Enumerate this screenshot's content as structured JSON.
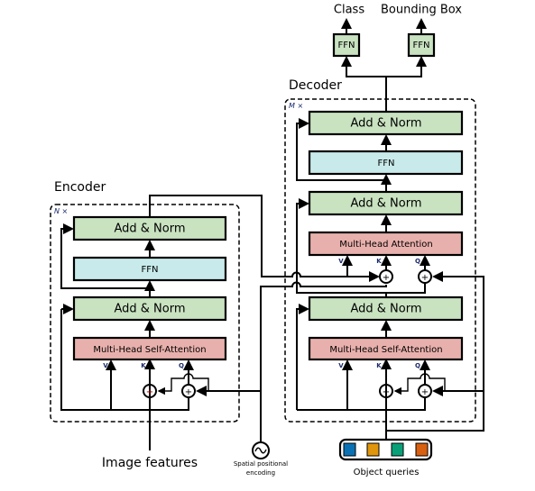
{
  "outputs": {
    "class": "Class",
    "bbox": "Bounding Box",
    "ffn": "FFN"
  },
  "encoder": {
    "title": "Encoder",
    "repeat": "N ×",
    "add_norm": "Add & Norm",
    "ffn": "FFN",
    "attention": "Multi-Head Self-Attention",
    "v": "V",
    "k": "K",
    "q": "Q"
  },
  "decoder": {
    "title": "Decoder",
    "repeat": "M ×",
    "add_norm": "Add & Norm",
    "ffn": "FFN",
    "cross_attention": "Multi-Head Attention",
    "self_attention": "Multi-Head Self-Attention",
    "v": "V",
    "k": "K",
    "q": "Q"
  },
  "inputs": {
    "image_features": "Image features",
    "pos_line1": "Spatial positional",
    "pos_line2": "encoding",
    "object_queries": "Object queries"
  },
  "colors": {
    "add_norm": "#c9e3c1",
    "ffn": "#c8eaea",
    "attention": "#e8b0ac",
    "queries": [
      "#0a72b4",
      "#e0960c",
      "#0aa077",
      "#d86010"
    ]
  }
}
